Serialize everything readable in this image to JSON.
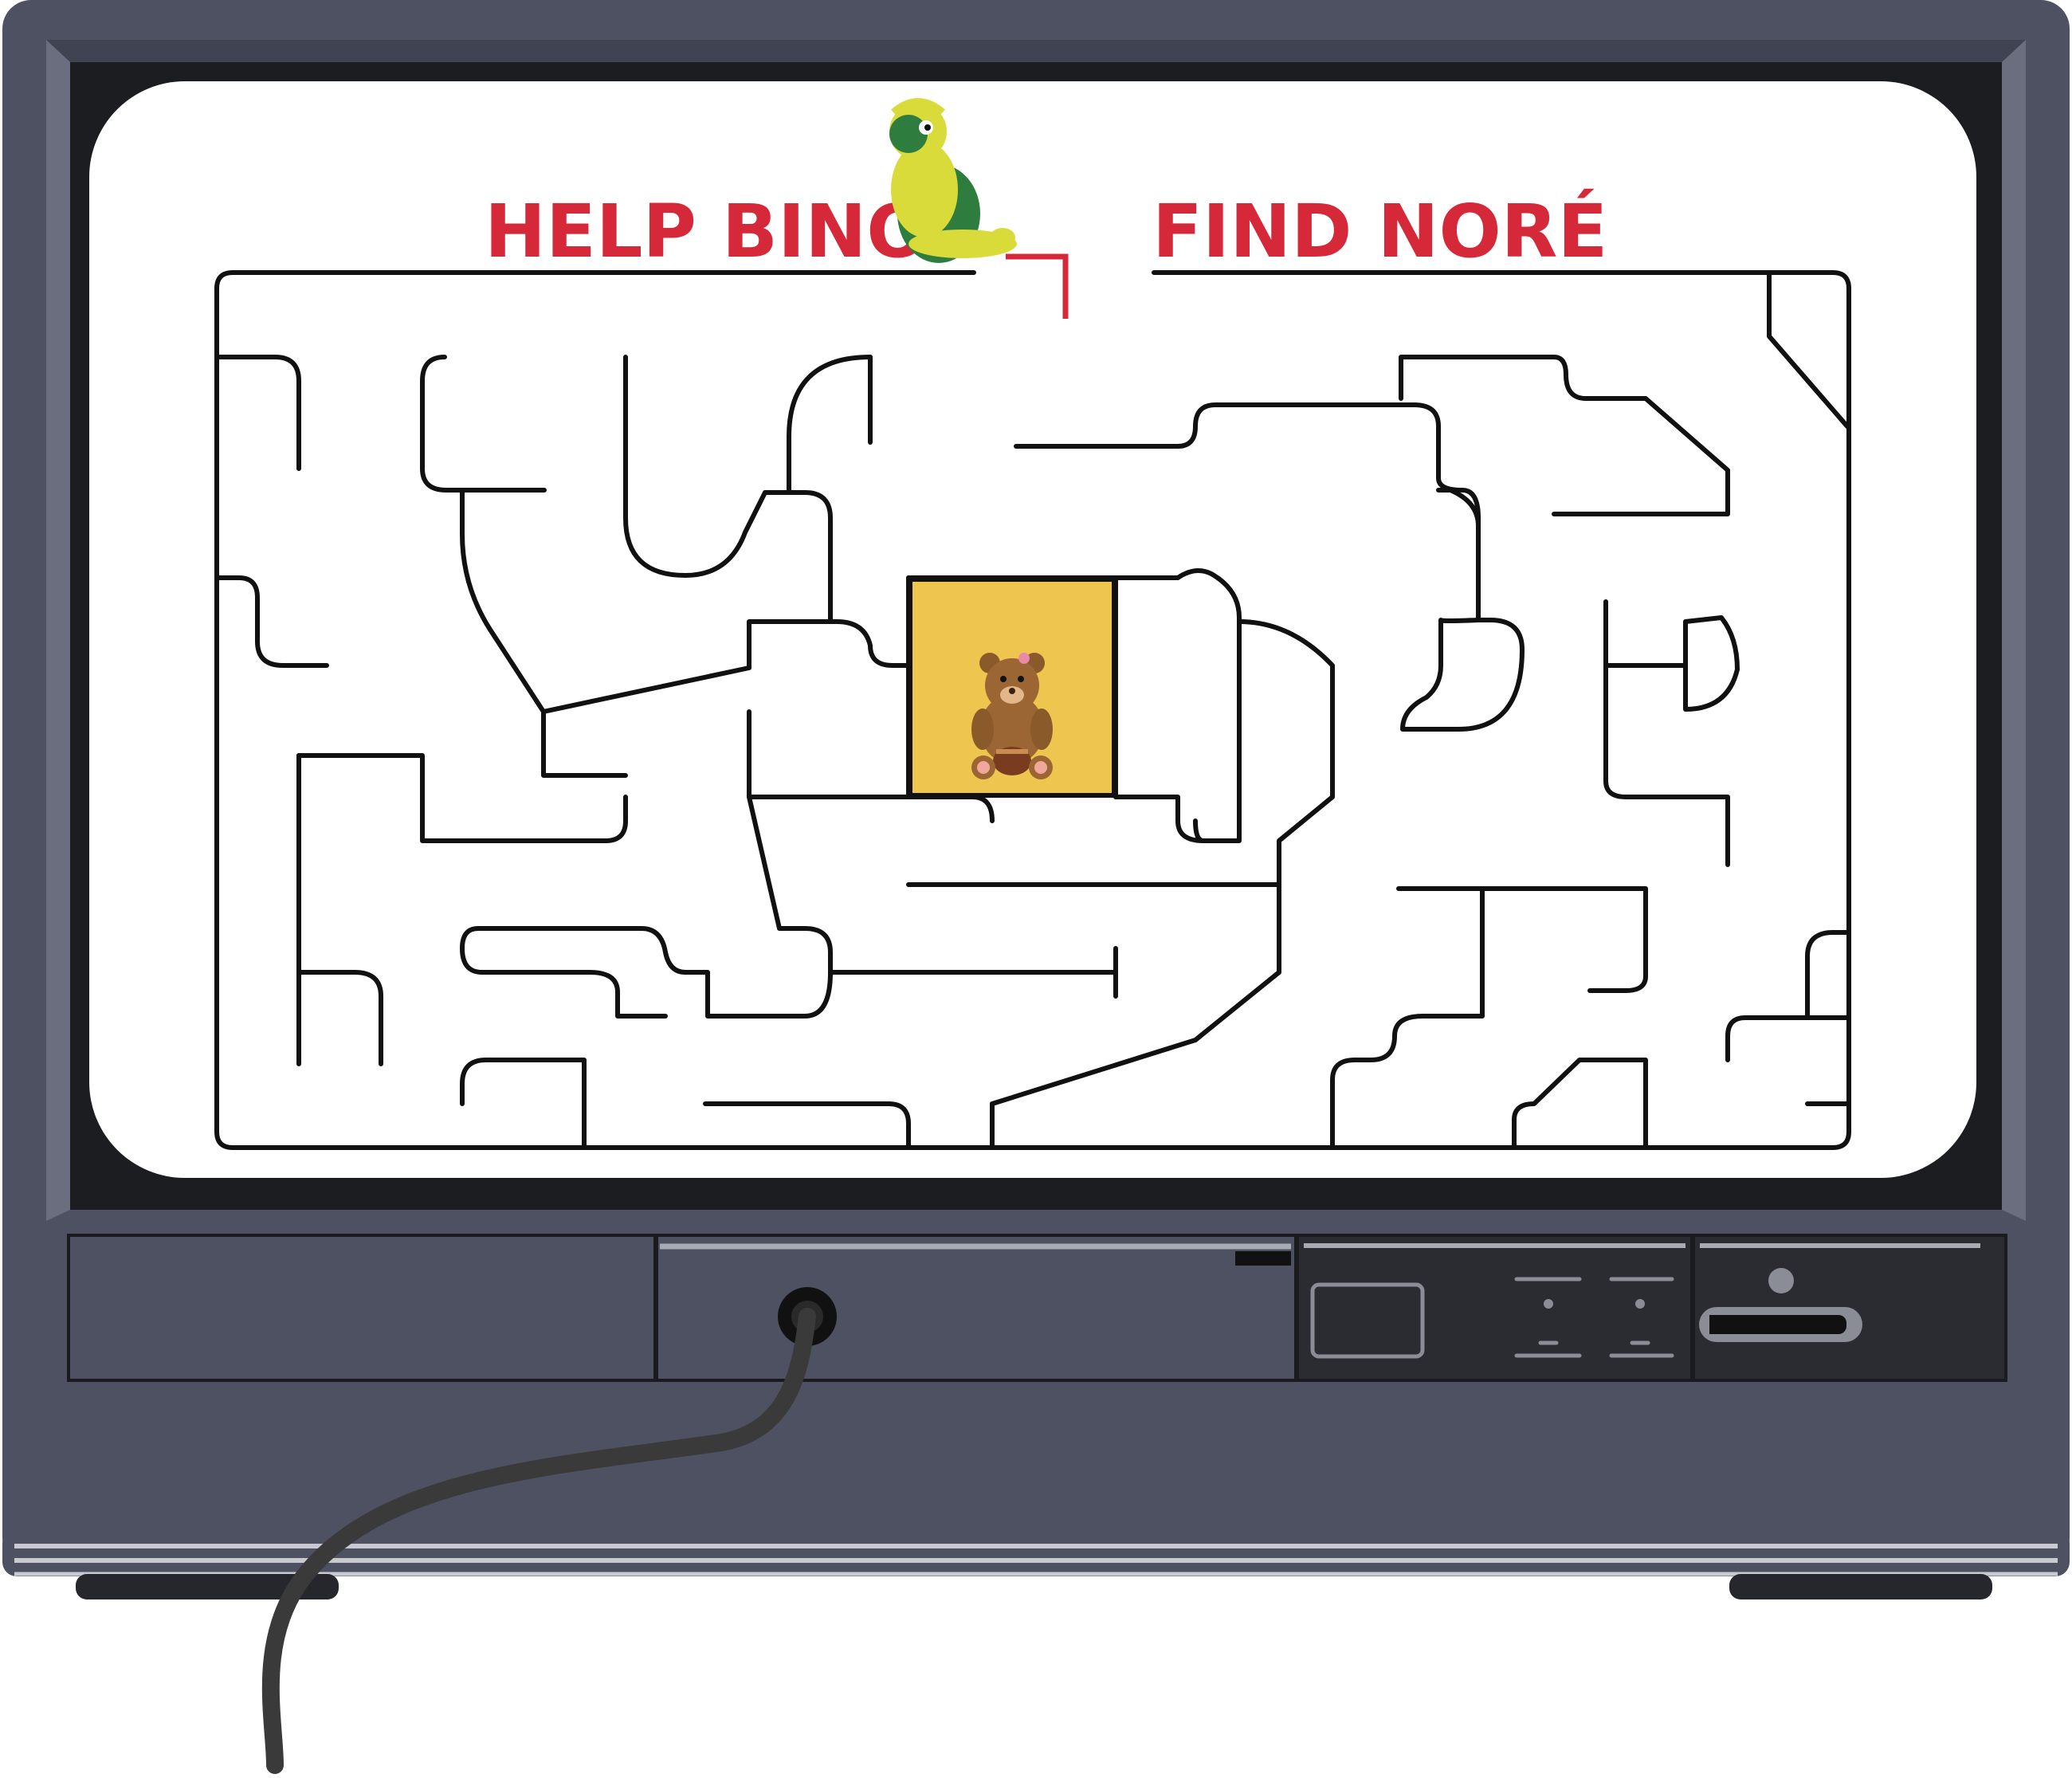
{
  "game": {
    "title_left": "HELP BINO",
    "title_right": "FIND NORÉ",
    "title_color": "#d5293a",
    "goal_tile_color": "#eec54e",
    "maze_wall_color": "#111111",
    "characters": {
      "start": "bino-turtle-icon",
      "goal": "nore-teddy-bear-icon"
    }
  },
  "tv": {
    "body_color": "#4d5162",
    "screen_bezel_color": "#1c1d20",
    "panel_dark_color": "#2b2c32",
    "cable_color": "#3a3a3a",
    "icons": [
      "power-jack-icon",
      "display-icon",
      "card-slot-icon",
      "indicator-light-icon"
    ]
  }
}
